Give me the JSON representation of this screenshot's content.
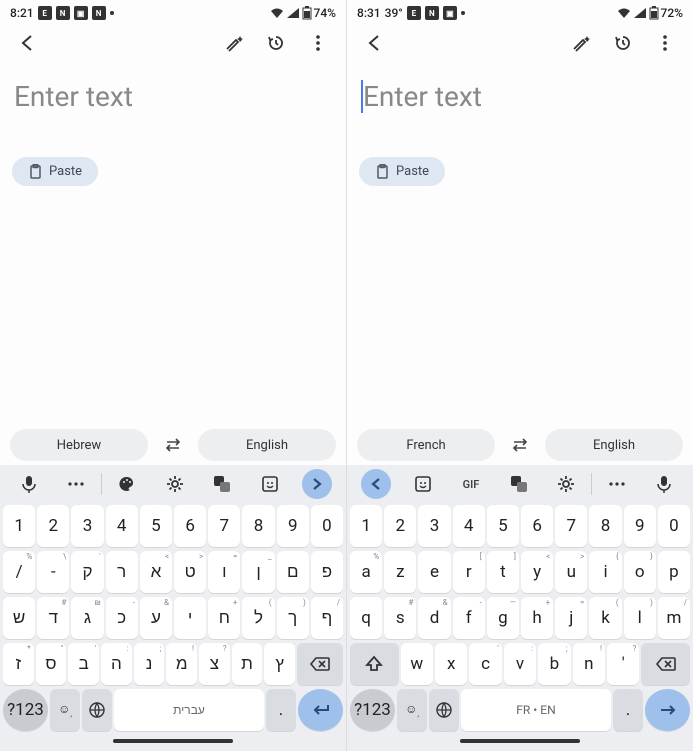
{
  "left": {
    "status": {
      "time": "8:21",
      "battery": "74%"
    },
    "input_placeholder": "Enter text",
    "paste_label": "Paste",
    "lang_a": "Hebrew",
    "lang_b": "English",
    "toolbar_icons": [
      "mic",
      "more",
      "palette",
      "gear",
      "translate",
      "sticker",
      "chev-right"
    ],
    "kb": {
      "row1": [
        {
          "k": "1"
        },
        {
          "k": "2"
        },
        {
          "k": "3"
        },
        {
          "k": "4"
        },
        {
          "k": "5"
        },
        {
          "k": "6"
        },
        {
          "k": "7"
        },
        {
          "k": "8"
        },
        {
          "k": "9"
        },
        {
          "k": "0"
        }
      ],
      "row2": [
        {
          "k": "/",
          "h": "%"
        },
        {
          "k": "-",
          "h": "\\"
        },
        {
          "k": "ק",
          "h": "'"
        },
        {
          "k": "ר",
          "h": ""
        },
        {
          "k": "א",
          "h": "<"
        },
        {
          "k": "ט",
          "h": ">"
        },
        {
          "k": "ו",
          "h": "="
        },
        {
          "k": "ן",
          "h": "_"
        },
        {
          "k": "ם",
          "h": ""
        },
        {
          "k": "פ",
          "h": ""
        }
      ],
      "row3": [
        {
          "k": "ש",
          "h": ""
        },
        {
          "k": "ד",
          "h": "#"
        },
        {
          "k": "ג",
          "h": "₪"
        },
        {
          "k": "כ",
          "h": "-"
        },
        {
          "k": "ע",
          "h": "&"
        },
        {
          "k": "י",
          "h": ""
        },
        {
          "k": "ח",
          "h": "+"
        },
        {
          "k": "ל",
          "h": "("
        },
        {
          "k": "ך",
          "h": ")"
        },
        {
          "k": "ף",
          "h": "/"
        }
      ],
      "row4": [
        {
          "k": "ז",
          "h": "*"
        },
        {
          "k": "ס",
          "h": "\""
        },
        {
          "k": "ב",
          "h": "'"
        },
        {
          "k": "ה",
          "h": ":"
        },
        {
          "k": "נ",
          "h": ";"
        },
        {
          "k": "מ",
          "h": "!"
        },
        {
          "k": "צ",
          "h": "?"
        },
        {
          "k": "ת",
          "h": ""
        },
        {
          "k": "ץ",
          "h": ""
        }
      ],
      "sym_label": "?123",
      "space_label": "עברית"
    }
  },
  "right": {
    "status": {
      "time": "8:31",
      "temp": "39°",
      "battery": "72%"
    },
    "input_placeholder": "Enter text",
    "paste_label": "Paste",
    "lang_a": "French",
    "lang_b": "English",
    "toolbar_icons": [
      "chev-left",
      "sticker",
      "gif",
      "translate",
      "gear",
      "more",
      "mic"
    ],
    "kb": {
      "row1": [
        {
          "k": "1"
        },
        {
          "k": "2"
        },
        {
          "k": "3"
        },
        {
          "k": "4"
        },
        {
          "k": "5"
        },
        {
          "k": "6"
        },
        {
          "k": "7"
        },
        {
          "k": "8"
        },
        {
          "k": "9"
        },
        {
          "k": "0"
        }
      ],
      "row2": [
        {
          "k": "a",
          "h": "%"
        },
        {
          "k": "z",
          "h": ""
        },
        {
          "k": "e",
          "h": ""
        },
        {
          "k": "r",
          "h": "["
        },
        {
          "k": "t",
          "h": "]"
        },
        {
          "k": "y",
          "h": "<"
        },
        {
          "k": "u",
          "h": ">"
        },
        {
          "k": "i",
          "h": "{"
        },
        {
          "k": "o",
          "h": "}"
        },
        {
          "k": "p",
          "h": ""
        }
      ],
      "row3": [
        {
          "k": "q",
          "h": ""
        },
        {
          "k": "s",
          "h": "#"
        },
        {
          "k": "d",
          "h": "&"
        },
        {
          "k": "f",
          "h": "-"
        },
        {
          "k": "g",
          "h": "—"
        },
        {
          "k": "h",
          "h": "+"
        },
        {
          "k": "j",
          "h": "="
        },
        {
          "k": "k",
          "h": "("
        },
        {
          "k": "l",
          "h": ")"
        },
        {
          "k": "m",
          "h": "/"
        }
      ],
      "row4": [
        {
          "k": "w",
          "h": ""
        },
        {
          "k": "x",
          "h": ""
        },
        {
          "k": "c",
          "h": "'"
        },
        {
          "k": "v",
          "h": ":"
        },
        {
          "k": "b",
          "h": ";"
        },
        {
          "k": "n",
          "h": "!"
        },
        {
          "k": "'",
          "h": "?"
        }
      ],
      "sym_label": "?123",
      "space_label": "FR • EN"
    }
  },
  "gif_label": "GIF"
}
